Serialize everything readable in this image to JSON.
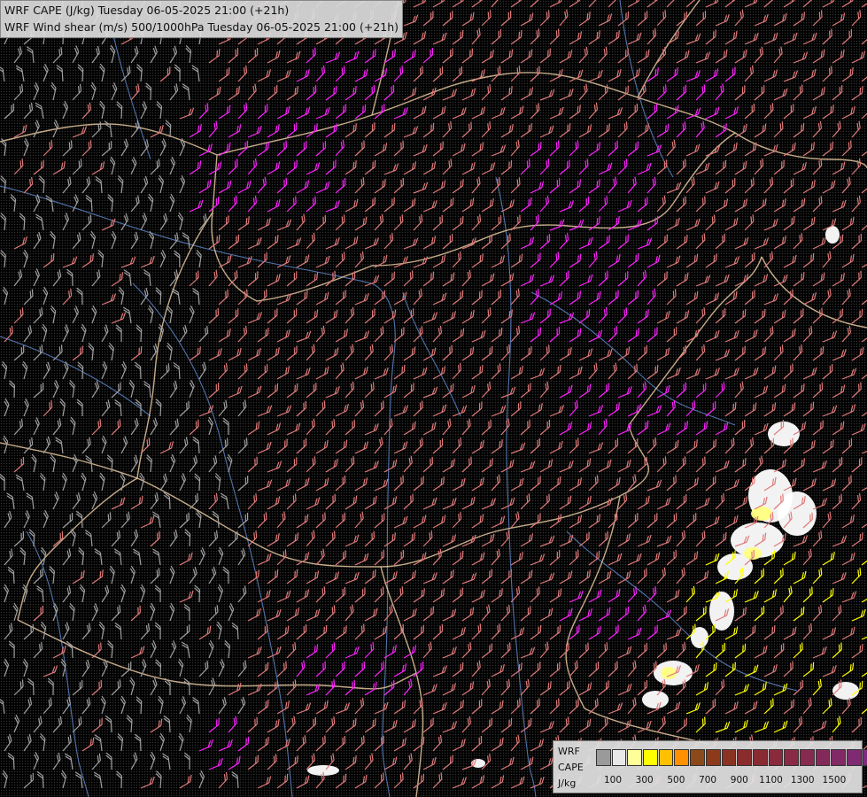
{
  "title": {
    "line1": "WRF CAPE (J/kg) Tuesday 06-05-2025 21:00 (+21h)",
    "line2": "WRF Wind shear (m/s) 500/1000hPa Tuesday 06-05-2025 21:00 (+21h)"
  },
  "legend": {
    "label_line1": "WRF",
    "label_line2": "CAPE",
    "label_line3": "J/kg",
    "colors": [
      "#9a9a9a",
      "#e8e8e8",
      "#ffff9a",
      "#ffff00",
      "#ffc000",
      "#ff9000",
      "#8c4a1a",
      "#8c3a1a",
      "#8a3322",
      "#8a2c2c",
      "#8a2a33",
      "#8a2a3c",
      "#8a2a46",
      "#862a50",
      "#842a5a",
      "#822a66",
      "#802a72",
      "#7e2a7e"
    ],
    "ticks": [
      "100",
      "300",
      "500",
      "700",
      "900",
      "1100",
      "1300",
      "1500"
    ]
  },
  "layer_colors": {
    "barb_magenta": "#ff22ff",
    "barb_pink": "#e07a7a",
    "barb_gray": "#a0a0a0",
    "barb_yellow": "#ffff00",
    "border": "#e8c8a0",
    "river": "#5a7fbf",
    "cape_white": "#ffffff",
    "cape_yellow": "#ffff80"
  }
}
